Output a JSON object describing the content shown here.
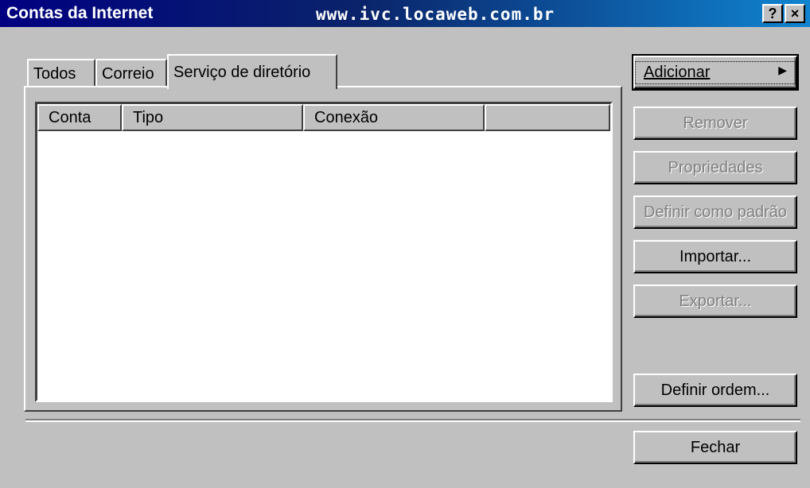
{
  "window": {
    "title": "Contas da Internet",
    "watermark": "www.ivc.locaweb.com.br",
    "help_button": "?",
    "close_button": "×"
  },
  "tabs": [
    {
      "label": "Todos",
      "active": false
    },
    {
      "label": "Correio",
      "active": false
    },
    {
      "label": "Serviço de diretório",
      "active": true
    }
  ],
  "list": {
    "columns": [
      "Conta",
      "Tipo",
      "Conexão",
      ""
    ],
    "rows": []
  },
  "buttons": {
    "add": "Adicionar",
    "remove": "Remover",
    "properties": "Propriedades",
    "set_default": "Definir como padrão",
    "import": "Importar...",
    "export": "Exportar...",
    "set_order": "Definir ordem...",
    "close": "Fechar"
  },
  "colors": {
    "title_bar_start": "#000080",
    "title_bar_end": "#1084d0",
    "face": "#c0c0c0",
    "disabled_text": "#808080"
  }
}
